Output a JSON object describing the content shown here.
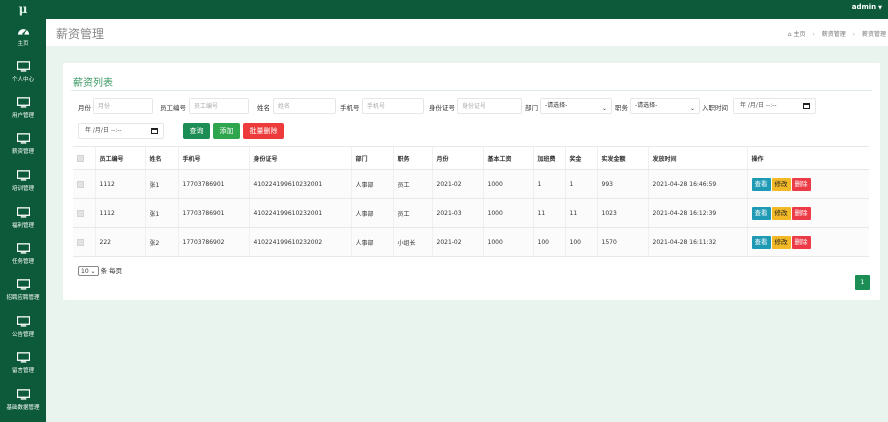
{
  "app": {
    "logo": "μ",
    "user": "admin"
  },
  "sidebar": {
    "items": [
      {
        "label": "主页",
        "icon": "dashboard-icon"
      },
      {
        "label": "个人中心",
        "icon": "monitor-icon"
      },
      {
        "label": "用户管理",
        "icon": "monitor-icon"
      },
      {
        "label": "薪资管理",
        "icon": "monitor-icon"
      },
      {
        "label": "培训管理",
        "icon": "monitor-icon"
      },
      {
        "label": "福利管理",
        "icon": "monitor-icon"
      },
      {
        "label": "任务管理",
        "icon": "monitor-icon"
      },
      {
        "label": "招聘应聘管理",
        "icon": "monitor-icon"
      },
      {
        "label": "公告管理",
        "icon": "monitor-icon"
      },
      {
        "label": "留言管理",
        "icon": "monitor-icon"
      },
      {
        "label": "基础数据管理",
        "icon": "monitor-icon"
      }
    ]
  },
  "header": {
    "title": "薪资管理",
    "breadcrumb": [
      "主页",
      "薪资管理",
      "薪资管理"
    ]
  },
  "card": {
    "title": "薪资列表"
  },
  "filters": {
    "month": {
      "label": "月份",
      "placeholder": "月份"
    },
    "emp_no": {
      "label": "员工编号",
      "placeholder": "员工编号"
    },
    "name": {
      "label": "姓名",
      "placeholder": "姓名"
    },
    "phone": {
      "label": "手机号",
      "placeholder": "手机号"
    },
    "idcard": {
      "label": "身份证号",
      "placeholder": "身份证号"
    },
    "dept": {
      "label": "部门",
      "value": "-请选择-"
    },
    "position": {
      "label": "职务",
      "value": "-请选择-"
    },
    "hire_time": {
      "label": "入职时间",
      "start": "年 /月/日 --:--",
      "end": "年 /月/日 --:--"
    }
  },
  "buttons": {
    "query": "查询",
    "add": "添加",
    "batch_delete": "批量删除"
  },
  "table": {
    "columns": [
      "员工编号",
      "姓名",
      "手机号",
      "身份证号",
      "部门",
      "职务",
      "月份",
      "基本工资",
      "加班费",
      "奖金",
      "实发金额",
      "发放时间",
      "操作"
    ],
    "rows": [
      [
        "1112",
        "张1",
        "17703786901",
        "410224199610232001",
        "人事部",
        "员工",
        "2021-02",
        "1000",
        "1",
        "1",
        "993",
        "2021-04-28 16:46:59"
      ],
      [
        "1112",
        "张1",
        "17703786901",
        "410224199610232001",
        "人事部",
        "员工",
        "2021-03",
        "1000",
        "11",
        "11",
        "1023",
        "2021-04-28 16:12:39"
      ],
      [
        "222",
        "张2",
        "17703786902",
        "410224199610232002",
        "人事部",
        "小组长",
        "2021-02",
        "1000",
        "100",
        "100",
        "1570",
        "2021-04-28 16:11:32"
      ]
    ],
    "actions": {
      "view": "查看",
      "edit": "修改",
      "delete": "删除"
    }
  },
  "pagination": {
    "page_size": "10",
    "page_size_suffix": "条 每页",
    "current_page": "1"
  }
}
